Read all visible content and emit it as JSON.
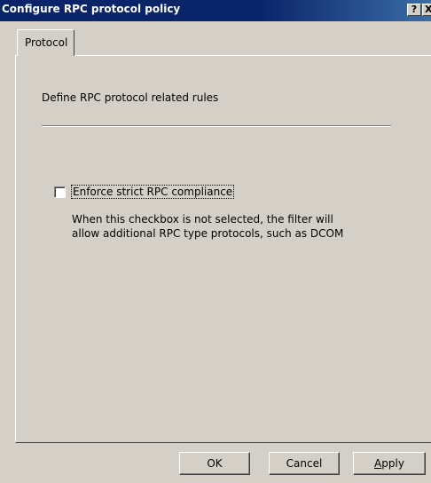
{
  "window": {
    "title": "Configure RPC protocol policy",
    "help_glyph": "?",
    "close_glyph": "X"
  },
  "tabs": [
    {
      "label": "Protocol",
      "selected": true
    }
  ],
  "content": {
    "section_title": "Define RPC protocol related rules",
    "checkbox": {
      "label": "Enforce strict RPC compliance",
      "checked": false
    },
    "description_lines": [
      "When this checkbox is not selected, the filter will",
      "allow additional RPC type protocols, such as DCOM"
    ]
  },
  "buttons": {
    "ok": "OK",
    "cancel": "Cancel",
    "apply_accel": "A",
    "apply_rest": "pply"
  },
  "colors": {
    "titlebar": "#0a246a",
    "face": "#d4d0c8"
  }
}
